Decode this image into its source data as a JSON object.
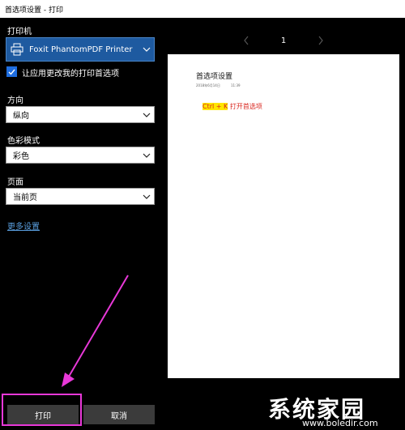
{
  "window": {
    "title": "首选项设置 - 打印"
  },
  "printer": {
    "section_label": "打印机",
    "selected": "Foxit PhantomPDF Printer",
    "icon": "printer-icon"
  },
  "app_options": {
    "checkbox_label": "让应用更改我的打印首选项",
    "checked": true
  },
  "orientation": {
    "label": "方向",
    "value": "纵向"
  },
  "color_mode": {
    "label": "色彩模式",
    "value": "彩色"
  },
  "pages": {
    "label": "页面",
    "value": "当前页"
  },
  "more_settings": "更多设置",
  "buttons": {
    "print": "打印",
    "cancel": "取消"
  },
  "preview": {
    "page_number": "1",
    "doc_title": "首选项设置",
    "doc_date": "2018年6月14日",
    "doc_time": "11:39",
    "shortcut": "Ctrl + K",
    "shortcut_desc": " 打开首选项"
  },
  "watermark": {
    "main": "系统家园",
    "sub": "www.boledir.com"
  },
  "colors": {
    "accent": "#1e5aa0",
    "highlight": "#e838d8",
    "link": "#5a9fe0"
  }
}
